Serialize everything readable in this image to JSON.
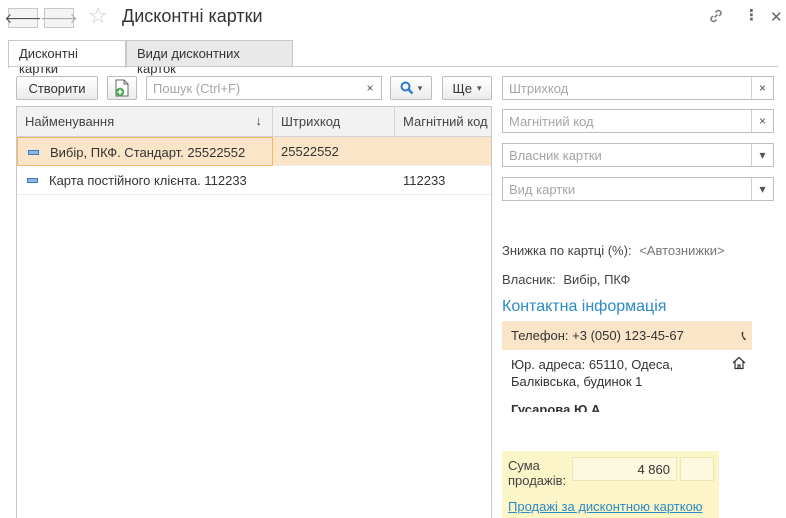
{
  "window": {
    "title": "Дисконтні картки",
    "back_icon": "arrow-left-icon",
    "forward_icon": "arrow-right-icon",
    "favorite_icon": "star-icon",
    "link_icon": "link-icon",
    "more_icon": "more-vertical-icon",
    "close_icon": "close-icon"
  },
  "tabs": [
    {
      "label": "Дисконтні картки",
      "active": true
    },
    {
      "label": "Види дисконтних карток",
      "active": false
    }
  ],
  "toolbar": {
    "create_label": "Створити",
    "search_placeholder": "Пошук (Ctrl+F)",
    "search_clear": "×",
    "more_label": "Ще"
  },
  "table": {
    "columns": [
      "Найменування",
      "Штрихкод",
      "Магнітний код"
    ],
    "sort_indicator": "↓",
    "rows": [
      {
        "name": "Вибір, ПКФ. Стандарт. 25522552",
        "barcode": "25522552",
        "magnetic": "",
        "selected": true
      },
      {
        "name": "Карта постійного клієнта. 112233",
        "barcode": "",
        "magnetic": "112233",
        "selected": false
      }
    ]
  },
  "filters": {
    "barcode_placeholder": "Штрихкод",
    "magnetic_placeholder": "Магнітний код",
    "owner_placeholder": "Власник картки",
    "type_placeholder": "Вид картки",
    "clear_symbol": "×",
    "dropdown_symbol": "▾"
  },
  "details": {
    "discount_label": "Знижка по картці (%):",
    "discount_value": "<Автознижки>",
    "owner_label": "Власник:",
    "owner_value": "Вибір, ПКФ",
    "contact_title": "Контактна інформація",
    "phone": "Телефон: +3 (050) 123-45-67",
    "address_line1": "Юр. адреса: 65110, Одеса,",
    "address_line2": "Балківська, будинок 1",
    "person": "Гусарова Ю.А.",
    "sales_label_1": "Сума",
    "sales_label_2": "продажів:",
    "sales_value": "4 860",
    "sales_link": "Продажі за дисконтною карткою"
  },
  "colors": {
    "selection": "#fbe5c8",
    "accent": "#2a8bc8",
    "sales_bg": "#fbf5c8"
  }
}
